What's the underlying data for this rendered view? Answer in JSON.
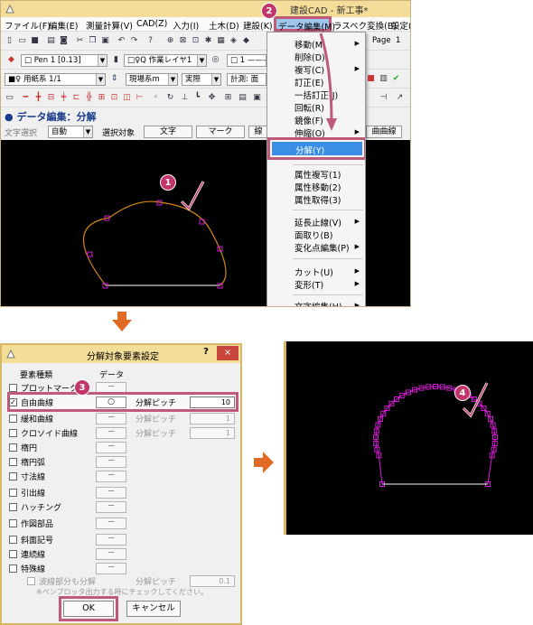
{
  "window": {
    "title": "建設CAD - 新工事*",
    "menus": [
      "ファイル(F)",
      "編集(E)",
      "測量計算(V)",
      "CAD(Z)",
      "入力(I)",
      "土木(D)",
      "建設(K)",
      "データ編集(M)",
      "ラスベク変換(B)",
      "設定(S)"
    ],
    "toolbar": {
      "pen_combo": "□ Pen 1 [0.13]",
      "layer_combo": "□♀Q 作業レイヤ1",
      "line_combo": "□ 1 ———",
      "page_label": "Page",
      "page_value": "1",
      "paper_combo": "■♀ 用紙系 1/1",
      "coord_combo": "現場系m",
      "scale_combo": "実際",
      "measure_label": "計測: 面"
    },
    "command": {
      "title": "データ編集：分解",
      "filter_label": "文字選択",
      "filter_value": "自動",
      "target_label": "選択対象",
      "btn_text": "文字",
      "btn_mark": "マーク",
      "btn_3": "線",
      "btn_curve": "曲曲線"
    }
  },
  "dropdown": {
    "items": [
      {
        "label": "移動(M)",
        "sub": true
      },
      {
        "label": "削除(D)",
        "sub": false
      },
      {
        "label": "複写(C)",
        "sub": true
      },
      {
        "label": "訂正(E)",
        "sub": false
      },
      {
        "label": "一括訂正(J)",
        "sub": false
      },
      {
        "label": "回転(R)",
        "sub": false
      },
      {
        "label": "鏡像(F)",
        "sub": false
      },
      {
        "label": "伸縮(O)",
        "sub": true
      },
      {
        "label": "分解(Y)",
        "sub": false,
        "highlight": true
      },
      {
        "label": "属性複写(1)",
        "sub": false
      },
      {
        "label": "属性移動(2)",
        "sub": false
      },
      {
        "label": "属性取得(3)",
        "sub": false
      },
      {
        "label": "延長止線(V)",
        "sub": true
      },
      {
        "label": "面取り(B)",
        "sub": false
      },
      {
        "label": "変化点編集(P)",
        "sub": true
      },
      {
        "label": "カット(U)",
        "sub": true
      },
      {
        "label": "変形(T)",
        "sub": true
      },
      {
        "label": "文字編集(H)",
        "sub": true
      }
    ]
  },
  "badges": [
    "1",
    "2",
    "3",
    "4"
  ],
  "dialog": {
    "title": "分解対象要素設定",
    "help": "?",
    "close": "×",
    "col_type": "要素種類",
    "col_data": "データ",
    "rows": [
      {
        "label": "プロットマーク",
        "checked": false,
        "data": "－",
        "pitch": "",
        "pitch_val": ""
      },
      {
        "label": "自由曲線",
        "checked": true,
        "data": "○",
        "pitch": "分解ピッチ",
        "pitch_val": "10"
      },
      {
        "label": "緩和曲線",
        "checked": false,
        "data": "－",
        "pitch": "分解ピッチ",
        "pitch_val": "1"
      },
      {
        "label": "クロソイド曲線",
        "checked": false,
        "data": "－",
        "pitch": "分解ピッチ",
        "pitch_val": "1"
      },
      {
        "label": "楕円",
        "checked": false,
        "data": "－",
        "pitch": "",
        "pitch_val": ""
      },
      {
        "label": "楕円弧",
        "checked": false,
        "data": "－",
        "pitch": "",
        "pitch_val": ""
      },
      {
        "label": "寸法線",
        "checked": false,
        "data": "－",
        "pitch": "",
        "pitch_val": ""
      },
      {
        "label": "引出線",
        "checked": false,
        "data": "－",
        "pitch": "",
        "pitch_val": ""
      },
      {
        "label": "ハッチング",
        "checked": false,
        "data": "－",
        "pitch": "",
        "pitch_val": ""
      },
      {
        "label": "作図部品",
        "checked": false,
        "data": "－",
        "pitch": "",
        "pitch_val": ""
      },
      {
        "label": "斜面記号",
        "checked": false,
        "data": "－",
        "pitch": "",
        "pitch_val": ""
      },
      {
        "label": "連続線",
        "checked": false,
        "data": "－",
        "pitch": "",
        "pitch_val": ""
      },
      {
        "label": "特殊線",
        "checked": false,
        "data": "－",
        "pitch": "",
        "pitch_val": ""
      }
    ],
    "dashed_label": "波線部分も分解",
    "dashed_pitch": "分解ピッチ",
    "dashed_val": "0.1",
    "note": "※ペンプロッタ出力する時にチェックしてください。",
    "ok": "OK",
    "cancel": "キャンセル"
  },
  "colors": {
    "title_bar": "#f3dd98",
    "highlight": "#c05a7a",
    "badge": "#c2356a",
    "arrow": "#e06a24",
    "curve_orange": "#d98a16",
    "curve_magenta": "#d21bd2"
  }
}
